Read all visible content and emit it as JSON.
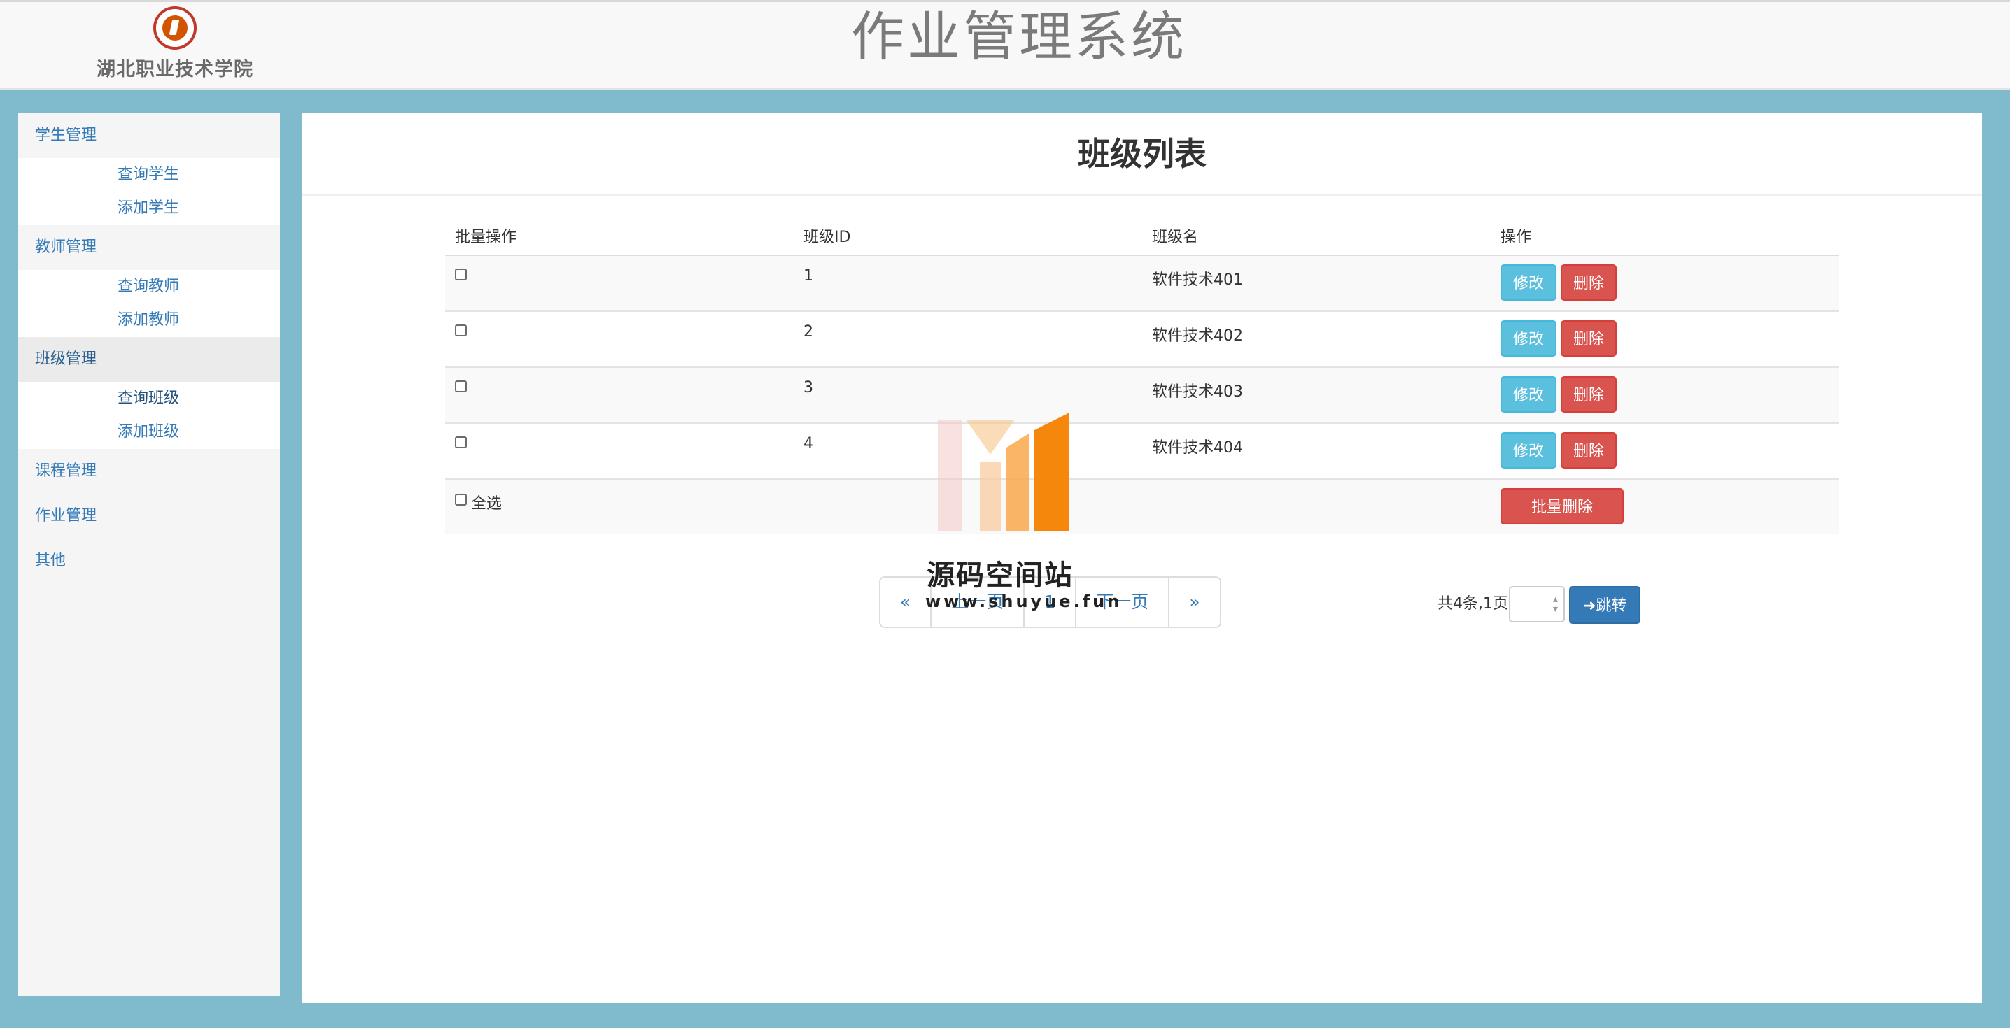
{
  "header": {
    "school_name": "湖北职业技术学院",
    "system_title": "作业管理系统"
  },
  "sidebar": {
    "groups": [
      {
        "title": "学生管理",
        "items": [
          "查询学生",
          "添加学生"
        ]
      },
      {
        "title": "教师管理",
        "items": [
          "查询教师",
          "添加教师"
        ]
      },
      {
        "title": "班级管理",
        "items": [
          "查询班级",
          "添加班级"
        ],
        "active": true
      },
      {
        "title": "课程管理",
        "items": []
      },
      {
        "title": "作业管理",
        "items": []
      },
      {
        "title": "其他",
        "items": []
      }
    ]
  },
  "main": {
    "title": "班级列表",
    "table": {
      "headers": [
        "批量操作",
        "班级ID",
        "班级名",
        "操作"
      ],
      "rows": [
        {
          "id": "1",
          "name": "软件技术401"
        },
        {
          "id": "2",
          "name": "软件技术402"
        },
        {
          "id": "3",
          "name": "软件技术403"
        },
        {
          "id": "4",
          "name": "软件技术404"
        }
      ],
      "edit_label": "修改",
      "delete_label": "删除",
      "select_all_label": "全选",
      "batch_delete_label": "批量删除"
    },
    "pager": {
      "first": "«",
      "prev": "上一页",
      "current": "1",
      "next": "下一页",
      "last": "»",
      "info": "共4条,1页",
      "jump_label": "➜跳转"
    }
  },
  "watermark": {
    "name": "源码空间站",
    "url": "www.shuyue.fun"
  },
  "colors": {
    "background": "#7fbbcd",
    "link": "#337ab7",
    "edit": "#5bc0de",
    "delete": "#d9534f",
    "primary": "#337ab7"
  }
}
